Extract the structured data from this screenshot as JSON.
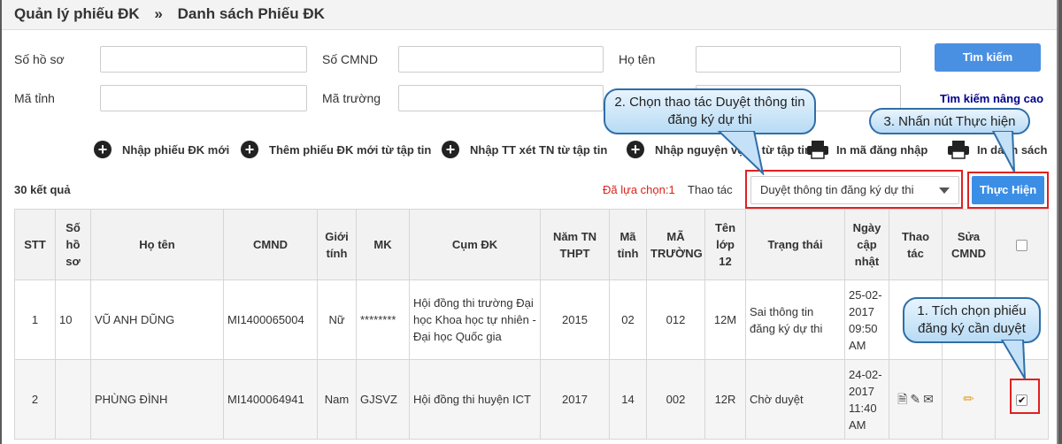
{
  "breadcrumb": {
    "section": "Quản lý phiếu ĐK",
    "separator": "»",
    "page": "Danh sách Phiếu ĐK"
  },
  "filters": {
    "so_ho_so": "Số hồ sơ",
    "so_cmnd": "Số CMND",
    "ho_ten": "Họ tên",
    "ma_tinh": "Mã tỉnh",
    "ma_truong": "Mã trường",
    "search_button": "Tìm kiếm",
    "advanced_search": "Tìm kiếm nâng cao"
  },
  "actions": {
    "new_form": "Nhập phiếu ĐK mới",
    "add_from_file": "Thêm phiếu ĐK mới từ tập tin",
    "import_tn": "Nhập TT xét TN từ tập tin",
    "import_nv": "Nhập nguyện vọng từ tập tin",
    "print_codes": "In mã đăng nhập",
    "print_list": "In danh sách"
  },
  "toolbar": {
    "result_count": "30 kết quả",
    "selected": "Đã lựa chọn:1",
    "operation_label": "Thao tác",
    "operation_value": "Duyệt thông tin đăng ký dự thi",
    "execute_button": "Thực Hiện"
  },
  "table": {
    "headers": [
      "STT",
      "Số hồ sơ",
      "Họ tên",
      "CMND",
      "Giới tính",
      "MK",
      "Cụm ĐK",
      "Năm TN THPT",
      "Mã tỉnh",
      "MÃ TRƯỜNG",
      "Tên lớp 12",
      "Trạng thái",
      "Ngày cập nhật",
      "Thao tác",
      "Sửa CMND"
    ],
    "rows": [
      {
        "stt": "1",
        "so_ho_so": "10",
        "ho_ten": "VŨ ANH DŨNG",
        "cmnd": "MI1400065004",
        "gioi_tinh": "Nữ",
        "mk": "********",
        "cum_dk": "Hội đồng thi trường Đại học Khoa học tự nhiên - Đại học Quốc gia",
        "nam_tn": "2015",
        "ma_tinh": "02",
        "ma_truong": "012",
        "lop": "12M",
        "trang_thai": "Sai thông tin đăng ký dự thi",
        "ngay": "25-02-2017 09:50 AM",
        "checked": false
      },
      {
        "stt": "2",
        "so_ho_so": "",
        "ho_ten": "PHÙNG ĐÌNH",
        "cmnd": "MI1400064941",
        "gioi_tinh": "Nam",
        "mk": "GJSVZ",
        "cum_dk": "Hội đồng thi huyện ICT",
        "nam_tn": "2017",
        "ma_tinh": "14",
        "ma_truong": "002",
        "lop": "12R",
        "trang_thai": "Chờ duyệt",
        "ngay": "24-02-2017 11:40 AM",
        "checked": true
      }
    ]
  },
  "callouts": {
    "step1": "1. Tích chọn phiếu đăng ký cần duyệt",
    "step2": "2. Chọn thao tác Duyệt thông tin đăng ký dự thi",
    "step3": "3. Nhấn nút Thực hiện"
  },
  "colors": {
    "accent": "#4a90e2",
    "highlight": "#e02020",
    "callout_border": "#2f6ea8"
  }
}
